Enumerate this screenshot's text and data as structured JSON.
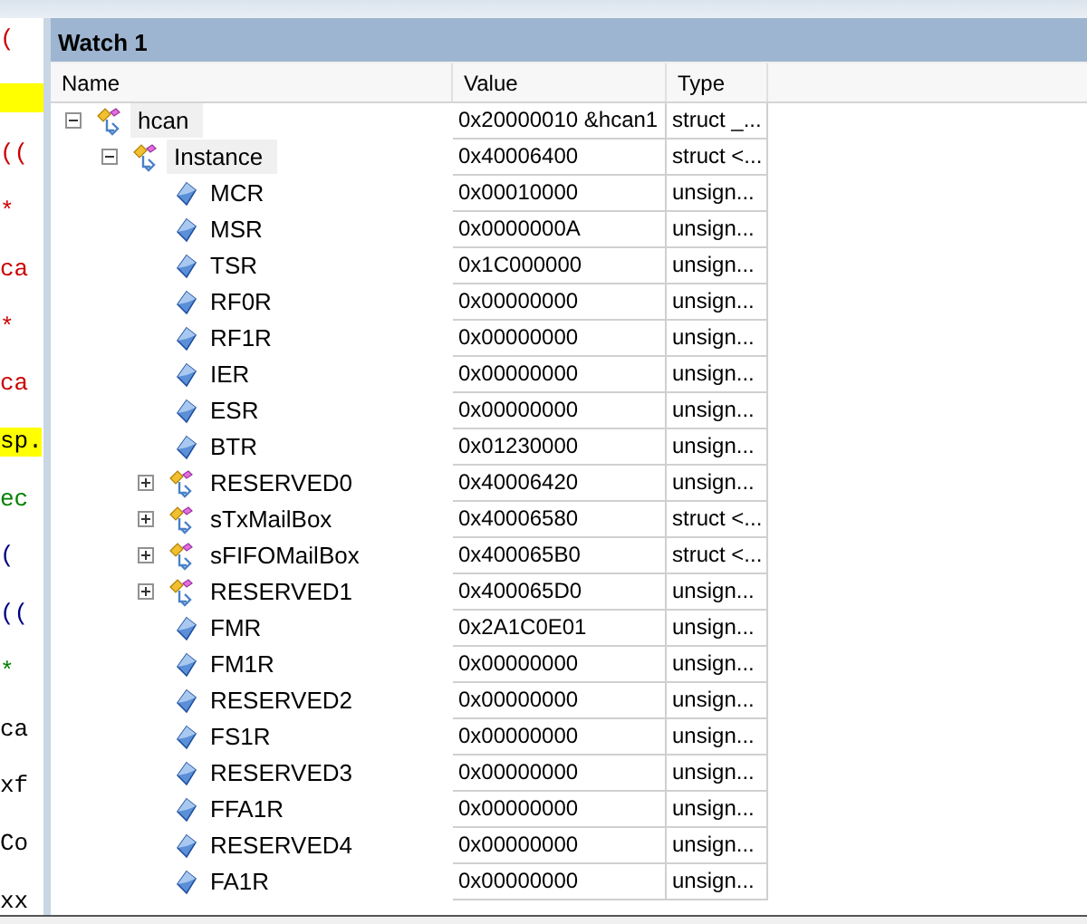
{
  "editor_fragments": [
    {
      "text": "(",
      "color": "#cc0000"
    },
    {
      "kind": "highlight"
    },
    {
      "text": "((",
      "color": "#cc0000"
    },
    {
      "text": "*",
      "color": "#cc0000"
    },
    {
      "text": "ca",
      "color": "#cc0000"
    },
    {
      "text": "*",
      "color": "#cc0000"
    },
    {
      "text": "ca",
      "color": "#cc0000"
    },
    {
      "text": "sp.",
      "highlight": true
    },
    {
      "text": "ec",
      "color": "#008000"
    },
    {
      "text": "(",
      "color": "#000080"
    },
    {
      "text": "((",
      "color": "#000080"
    },
    {
      "text": "*",
      "color": "#008000"
    },
    {
      "text": "ca"
    },
    {
      "text": "xf"
    },
    {
      "text": "Co"
    },
    {
      "text": "xx"
    }
  ],
  "window": {
    "title": "Watch 1"
  },
  "table": {
    "columns": [
      "Name",
      "Value",
      "Type"
    ],
    "rows": [
      {
        "name": "hcan",
        "value": "0x20000010 &hcan1",
        "type": "struct _...",
        "kind": "struct",
        "expanded": true,
        "children": [
          {
            "name": "Instance",
            "value": "0x40006400",
            "type": "struct <...",
            "kind": "struct",
            "expanded": true,
            "children": [
              {
                "name": "MCR",
                "value": "0x00010000",
                "type": "unsign...",
                "kind": "field"
              },
              {
                "name": "MSR",
                "value": "0x0000000A",
                "type": "unsign...",
                "kind": "field"
              },
              {
                "name": "TSR",
                "value": "0x1C000000",
                "type": "unsign...",
                "kind": "field"
              },
              {
                "name": "RF0R",
                "value": "0x00000000",
                "type": "unsign...",
                "kind": "field"
              },
              {
                "name": "RF1R",
                "value": "0x00000000",
                "type": "unsign...",
                "kind": "field"
              },
              {
                "name": "IER",
                "value": "0x00000000",
                "type": "unsign...",
                "kind": "field"
              },
              {
                "name": "ESR",
                "value": "0x00000000",
                "type": "unsign...",
                "kind": "field"
              },
              {
                "name": "BTR",
                "value": "0x01230000",
                "type": "unsign...",
                "kind": "field"
              },
              {
                "name": "RESERVED0",
                "value": "0x40006420",
                "type": "unsign...",
                "kind": "struct",
                "expanded": false
              },
              {
                "name": "sTxMailBox",
                "value": "0x40006580",
                "type": "struct <...",
                "kind": "struct",
                "expanded": false
              },
              {
                "name": "sFIFOMailBox",
                "value": "0x400065B0",
                "type": "struct <...",
                "kind": "struct",
                "expanded": false
              },
              {
                "name": "RESERVED1",
                "value": "0x400065D0",
                "type": "unsign...",
                "kind": "struct",
                "expanded": false
              },
              {
                "name": "FMR",
                "value": "0x2A1C0E01",
                "type": "unsign...",
                "kind": "field"
              },
              {
                "name": "FM1R",
                "value": "0x00000000",
                "type": "unsign...",
                "kind": "field"
              },
              {
                "name": "RESERVED2",
                "value": "0x00000000",
                "type": "unsign...",
                "kind": "field"
              },
              {
                "name": "FS1R",
                "value": "0x00000000",
                "type": "unsign...",
                "kind": "field"
              },
              {
                "name": "RESERVED3",
                "value": "0x00000000",
                "type": "unsign...",
                "kind": "field"
              },
              {
                "name": "FFA1R",
                "value": "0x00000000",
                "type": "unsign...",
                "kind": "field"
              },
              {
                "name": "RESERVED4",
                "value": "0x00000000",
                "type": "unsign...",
                "kind": "field"
              },
              {
                "name": "FA1R",
                "value": "0x00000000",
                "type": "unsign...",
                "kind": "field"
              }
            ]
          }
        ]
      }
    ]
  }
}
